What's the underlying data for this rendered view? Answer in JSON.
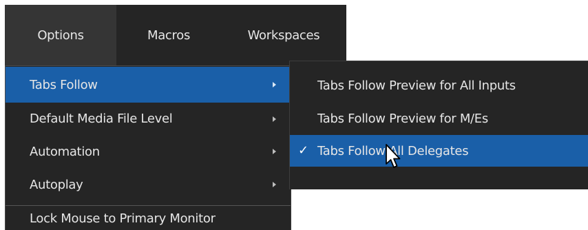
{
  "menubar": {
    "items": [
      {
        "label": "Options",
        "active": true
      },
      {
        "label": "Macros",
        "active": false
      },
      {
        "label": "Workspaces",
        "active": false
      }
    ]
  },
  "options_menu": {
    "items": [
      {
        "label": "Tabs Follow",
        "has_submenu": true,
        "highlighted": true
      },
      {
        "label": "Default Media File Level",
        "has_submenu": true
      },
      {
        "label": "Automation",
        "has_submenu": true
      },
      {
        "label": "Autoplay",
        "has_submenu": true
      },
      {
        "label": "Lock Mouse to Primary Monitor",
        "has_submenu": false
      }
    ]
  },
  "tabs_follow_submenu": {
    "items": [
      {
        "label": "Tabs Follow Preview for All Inputs",
        "checked": false
      },
      {
        "label": "Tabs Follow Preview for M/Es",
        "checked": false
      },
      {
        "label": "Tabs Follow All Delegates",
        "checked": true,
        "highlighted": true,
        "check_glyph": "✓"
      }
    ]
  },
  "colors": {
    "menu_background": "#252525",
    "active_menubar_item": "#353535",
    "highlight": "#1a5fa8",
    "text": "#e6e6e6"
  },
  "icons": {
    "submenu_arrow": "chevron-right-icon",
    "check": "checkmark-icon",
    "cursor": "mouse-pointer-icon"
  }
}
